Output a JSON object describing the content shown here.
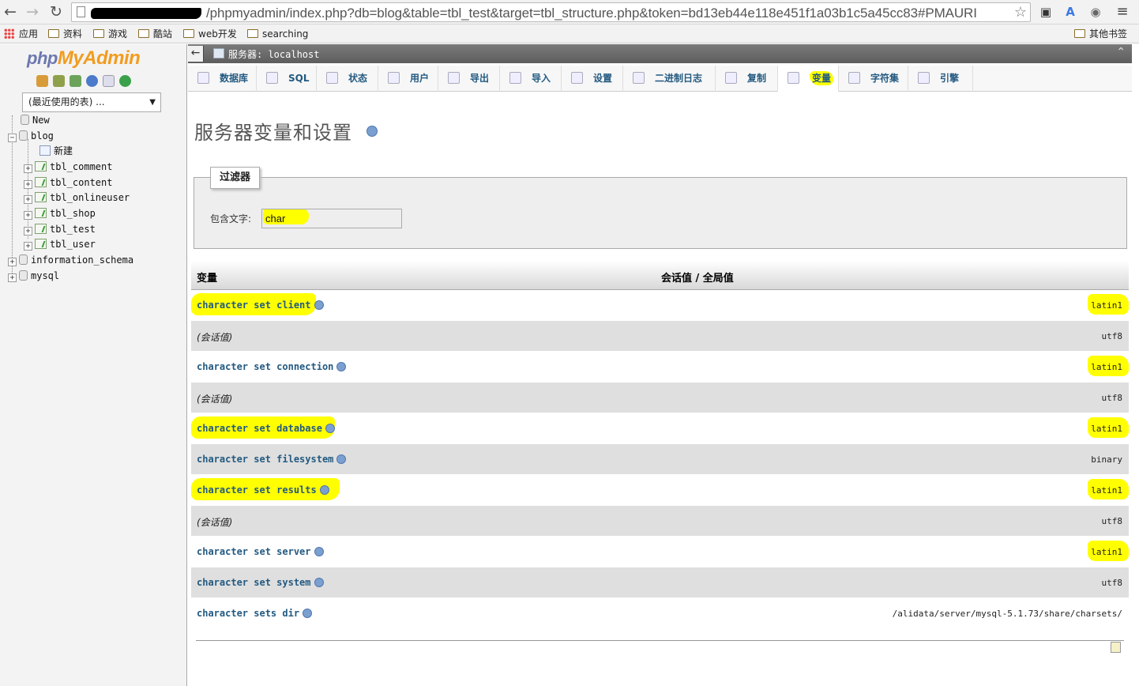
{
  "browser": {
    "url": "/phpmyadmin/index.php?db=blog&table=tbl_test&target=tbl_structure.php&token=bd13eb44e118e451f1a03b1c5a45cc83#PMAURI",
    "bookmarks": [
      "应用",
      "资料",
      "游戏",
      "酷站",
      "web开发",
      "searching"
    ],
    "other_bookmarks": "其他书签"
  },
  "sidebar": {
    "logo_php": "php",
    "logo_myadmin": "MyAdmin",
    "recent_tables": "(最近使用的表) ...",
    "tree": [
      {
        "label": "New",
        "level": 0
      },
      {
        "label": "blog",
        "level": 0
      },
      {
        "label": "新建",
        "level": 1
      },
      {
        "label": "tbl_comment",
        "level": 1
      },
      {
        "label": "tbl_content",
        "level": 1
      },
      {
        "label": "tbl_onlineuser",
        "level": 1
      },
      {
        "label": "tbl_shop",
        "level": 1
      },
      {
        "label": "tbl_test",
        "level": 1
      },
      {
        "label": "tbl_user",
        "level": 1
      },
      {
        "label": "information_schema",
        "level": 0
      },
      {
        "label": "mysql",
        "level": 0
      }
    ]
  },
  "server_bar": {
    "label": "服务器: localhost"
  },
  "tabs": [
    "数据库",
    "SQL",
    "状态",
    "用户",
    "导出",
    "导入",
    "设置",
    "二进制日志",
    "复制",
    "变量",
    "字符集",
    "引擎"
  ],
  "active_tab": "变量",
  "page": {
    "title": "服务器变量和设置",
    "filter_legend": "过滤器",
    "filter_label": "包含文字:",
    "filter_value": "char"
  },
  "variables": {
    "headers": [
      "变量",
      "会话值 / 全局值"
    ],
    "rows": [
      {
        "name": "character set client",
        "value": "latin1",
        "session": false
      },
      {
        "name": "(会话值)",
        "value": "utf8",
        "session": true
      },
      {
        "name": "character set connection",
        "value": "latin1",
        "session": false
      },
      {
        "name": "(会话值)",
        "value": "utf8",
        "session": true
      },
      {
        "name": "character set database",
        "value": "latin1",
        "session": false
      },
      {
        "name": "character set filesystem",
        "value": "binary",
        "session": false
      },
      {
        "name": "character set results",
        "value": "latin1",
        "session": false
      },
      {
        "name": "(会话值)",
        "value": "utf8",
        "session": true
      },
      {
        "name": "character set server",
        "value": "latin1",
        "session": false
      },
      {
        "name": "character set system",
        "value": "utf8",
        "session": false
      },
      {
        "name": "character sets dir",
        "value": "/alidata/server/mysql-5.1.73/share/charsets/",
        "session": false
      }
    ]
  },
  "colors": {
    "highlight": "#ffff00",
    "link": "#235a81",
    "logo_orange": "#f29c1f",
    "logo_blue": "#6c78af"
  }
}
